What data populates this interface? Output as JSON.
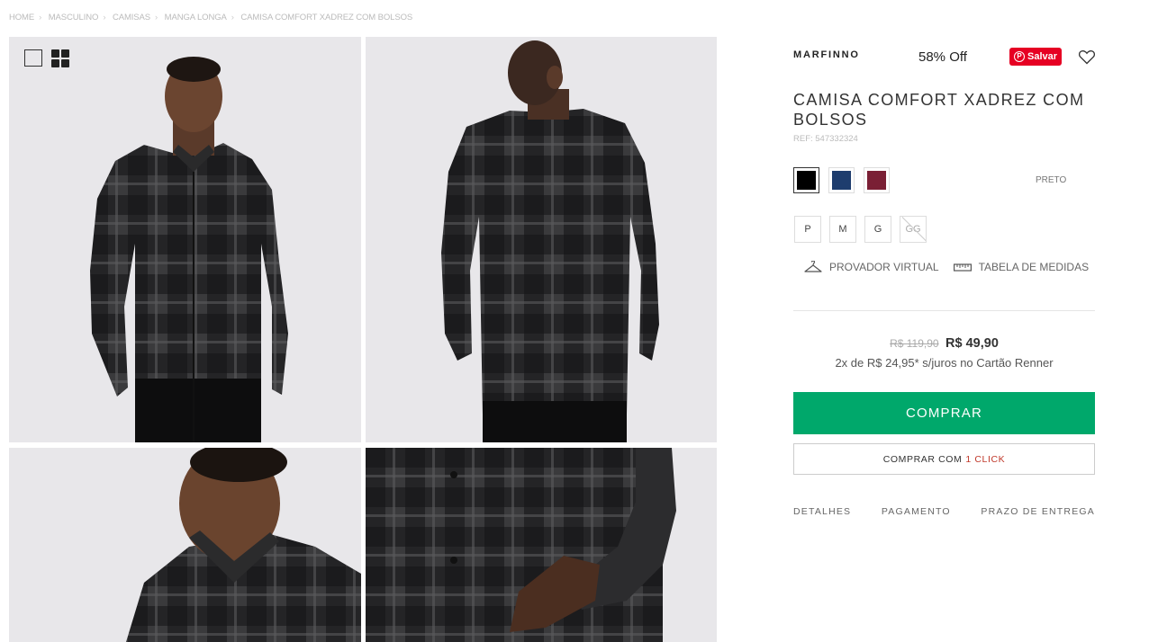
{
  "breadcrumb": [
    "HOME",
    "MASCULINO",
    "CAMISAS",
    "MANGA LONGA",
    "CAMISA COMFORT XADREZ COM BOLSOS"
  ],
  "product": {
    "brand": "MARFINNO",
    "discount": "58% Off",
    "pin_label": "Salvar",
    "title": "CAMISA COMFORT XADREZ COM BOLSOS",
    "ref": "REF: 547332324",
    "selected_color": "PRETO",
    "colors": [
      {
        "name": "preto",
        "hex": "#000000",
        "selected": true
      },
      {
        "name": "azul",
        "hex": "#1e3d6e",
        "selected": false
      },
      {
        "name": "bordo",
        "hex": "#7a1f35",
        "selected": false
      }
    ],
    "sizes": [
      {
        "label": "P",
        "available": true
      },
      {
        "label": "M",
        "available": true
      },
      {
        "label": "G",
        "available": true
      },
      {
        "label": "GG",
        "available": false
      }
    ],
    "old_price": "R$ 119,90",
    "price": "R$ 49,90",
    "installments": "2x de R$ 24,95* s/juros no Cartão Renner"
  },
  "tools": {
    "virtual_fitting": "PROVADOR VIRTUAL",
    "size_chart": "TABELA DE MEDIDAS"
  },
  "actions": {
    "buy": "COMPRAR",
    "one_click_prefix": "COMPRAR COM",
    "one_click_accent": "1 CLICK"
  },
  "tabs": [
    "DETALHES",
    "PAGAMENTO",
    "PRAZO DE ENTREGA"
  ],
  "colors": {
    "buy_button": "#00a86b",
    "pinterest": "#e60023",
    "accent_red": "#c0392b"
  }
}
